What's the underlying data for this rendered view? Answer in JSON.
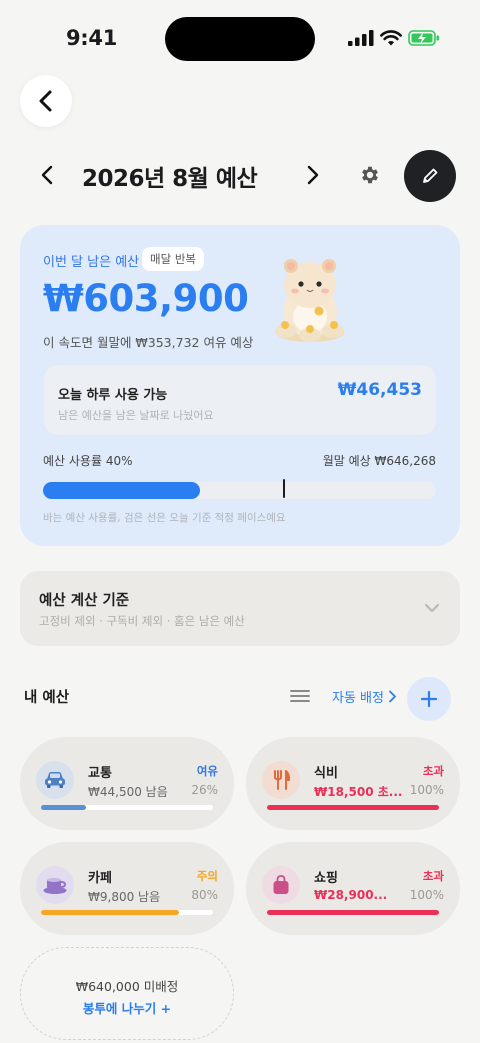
{
  "status_bar": {
    "time": "9:41"
  },
  "header": {
    "title": "2026년 8월 예산"
  },
  "summary": {
    "label": "이번 달 남은 예산",
    "badge": "매달 반복",
    "amount": "₩603,900",
    "forecast": "이 속도면 월말에 ₩353,732 여유 예상",
    "daily": {
      "title": "오늘 하루 사용 가능",
      "subtitle": "남은 예산을 남은 날짜로 나눴어요",
      "amount": "₩46,453"
    },
    "usage_label": "예산 사용률 40%",
    "usage_rate": 0.4,
    "pace_marker": 0.61,
    "projected": "월말 예상 ₩646,268",
    "bar_note": "바는 예산 사용률, 검은 선은 오늘 기준 적정 페이스예요"
  },
  "criteria": {
    "title": "예산 계산 기준",
    "subtitle": "고정비 제외 · 구독비 제외 · 홈은 남은 예산"
  },
  "my_budget": {
    "title": "내 예산",
    "auto_label": "자동 배정",
    "cards": [
      {
        "name": "교통",
        "amount": "₩44,500 남음",
        "status": "여유",
        "percent": "26%",
        "progress": 0.26,
        "status_color": "#3478e8",
        "bar_color": "#5b8fd6",
        "icon": "car-icon",
        "icon_bg": "#d8e0eb",
        "over": false
      },
      {
        "name": "식비",
        "amount": "₩18,500 초...",
        "status": "초과",
        "percent": "100%",
        "progress": 1.0,
        "status_color": "#ec2f56",
        "bar_color": "#ec2f56",
        "icon": "fork-knife-icon",
        "icon_bg": "#f3dcd2",
        "over": true
      },
      {
        "name": "카페",
        "amount": "₩9,800 남음",
        "status": "주의",
        "percent": "80%",
        "progress": 0.8,
        "status_color": "#f5a623",
        "bar_color": "#f5a623",
        "icon": "coffee-cup-icon",
        "icon_bg": "#e2dcef",
        "over": false
      },
      {
        "name": "쇼핑",
        "amount": "₩28,900...",
        "status": "초과",
        "percent": "100%",
        "progress": 1.0,
        "status_color": "#ec2f56",
        "bar_color": "#ec2f56",
        "icon": "shopping-bag-icon",
        "icon_bg": "#eedbe3",
        "over": true
      }
    ],
    "unassigned": {
      "amount": "₩640,000 미배정",
      "link": "봉투에 나누기 +"
    }
  },
  "colors": {
    "accent": "#2a7ef0",
    "danger": "#ec2f56",
    "warning": "#f5a623"
  }
}
